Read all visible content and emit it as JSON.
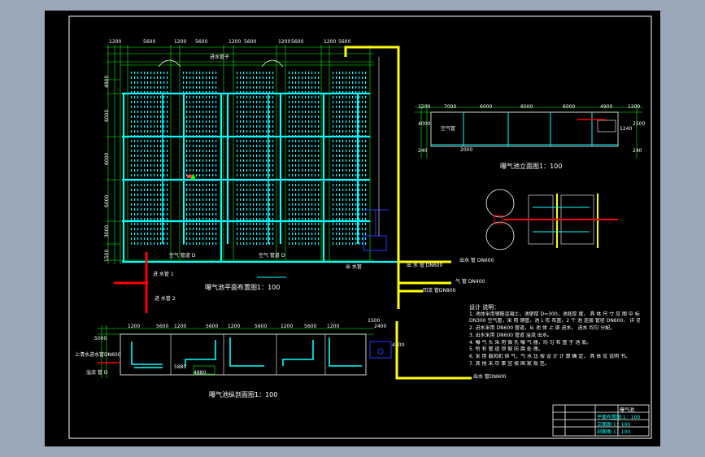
{
  "colors": {
    "background": "#9aa7b8",
    "sheet": "#000000",
    "frame": "#ffffff",
    "pipe_main": "#ffff00",
    "pipe_cyan": "#00ffff",
    "pipe_red": "#ff0000",
    "grid": "#00ff00",
    "diffuser": "#00ffff",
    "equipment": "#1e3cff"
  },
  "plan": {
    "title": "曝气池平面布置图1：100",
    "top_dims": [
      "1200",
      "5600",
      "1200",
      "5600",
      "1200",
      "5600",
      "1200",
      "5600",
      "1200",
      "5600"
    ],
    "left_dims": [
      "4800",
      "6000",
      "6000",
      "6000",
      "3000",
      "1500"
    ],
    "inlet_label": "进水管子",
    "pipe_labels": [
      "进 水管 1",
      "进 水管 2",
      "空气 管道 D",
      "空气 管道 D",
      "出 水管",
      "出 水 管 DN600",
      "气 管 DN400",
      "回流 管DN800",
      "出水 管 DN600"
    ]
  },
  "elevation": {
    "title": "曝气池立面图1：100",
    "dims": [
      "1200",
      "7000",
      "6000",
      "6000",
      "6000",
      "4900",
      "1200"
    ],
    "side_dims": [
      "4000",
      "240",
      "2000",
      "2500",
      "240",
      "1240"
    ],
    "tag": "空气管"
  },
  "section": {
    "title": "曝气池纵剖面图1：100",
    "dims": [
      "1200",
      "5600",
      "1200",
      "5600",
      "1200",
      "5600",
      "1200",
      "5600",
      "1200",
      "2400"
    ],
    "left_labels": [
      "上清水进水管DN600",
      "溢流 管 D"
    ],
    "side_dims": [
      "5000",
      "4500",
      "1500"
    ],
    "inner_dims": [
      "5880",
      "4880"
    ],
    "pipe_label": "出水 管DN600"
  },
  "notes": {
    "title": "设计 说明：",
    "items": [
      "1. 池体采用钢筋混凝土，池壁厚 D=300，池底厚 度， 具 体 尺 寸 见 图 中 标 注",
      "DN300 空气管，采 用 钢管，池 L 形 布置，2 个 池 连接 管径 DN600， 详 见 施工 图。",
      "2. 进水采用 DN600 管道，从 池 体 上 部 进水， 进水 均匀 分配。",
      "3. 出水采用 DN600 管道 溢流 出水。",
      "4. 曝 气 头 采 用 微 孔 曝 气 器，均 匀 布 置 于 池 底。",
      "5. 所 有 管 道 须 做 防 腐 处 理。",
      "6. 采 用 鼓风机 供 气，气 水 比 按 设 计 计 算 确 定， 具 体 见 说明 书。",
      "7. 其 他 未 尽 事 宜 按 国 家 规 范。"
    ]
  },
  "title_block": {
    "rows": [
      "曝气池",
      "平面布置图 1：100",
      "立面图 1：100",
      "剖面图 1：100"
    ]
  }
}
